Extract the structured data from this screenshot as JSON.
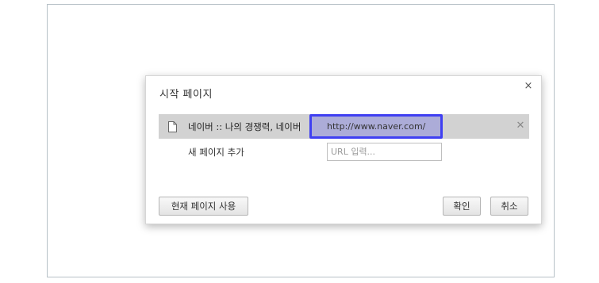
{
  "dialog": {
    "title": "시작 페이지",
    "close_glyph": "×"
  },
  "pages": [
    {
      "title": "네이버 :: 나의 경쟁력, 네이버",
      "url": "http://www.naver.com/",
      "remove_glyph": "✕"
    }
  ],
  "add_page": {
    "label": "새 페이지 추가",
    "placeholder": "URL 입력..."
  },
  "buttons": {
    "use_current": "현재 페이지 사용",
    "ok": "확인",
    "cancel": "취소"
  },
  "colors": {
    "highlight_border": "#3f3ff2",
    "row_background": "#d2d2d2"
  },
  "icons": {
    "page": "document-icon",
    "close": "close-icon",
    "remove": "remove-icon"
  }
}
